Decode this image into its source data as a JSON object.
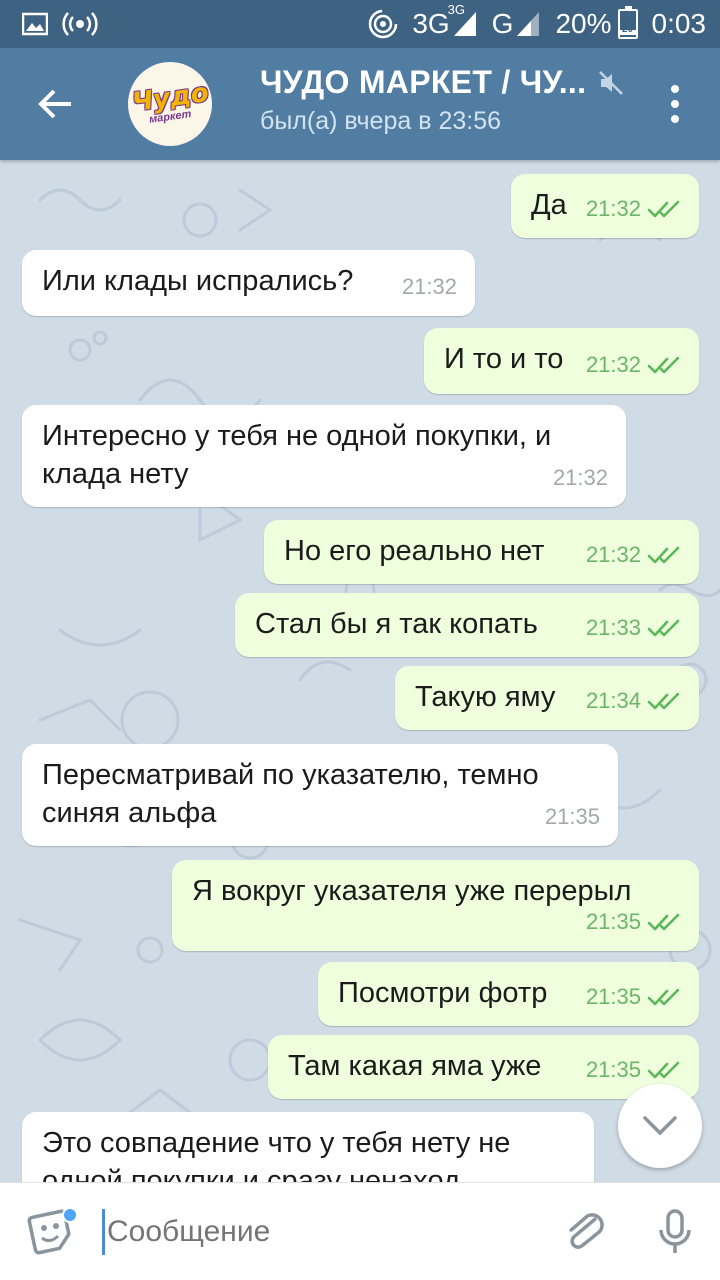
{
  "status_bar": {
    "network_3g": "3G",
    "network_3g_small": "3G",
    "network_g": "G",
    "battery_percent": "20%",
    "battery_level_text": "20",
    "battery_level": 0.2,
    "time": "0:03"
  },
  "header": {
    "title": "ЧУДО МАРКЕТ / ЧУ...",
    "subtitle": "был(а) вчера в 23:56",
    "avatar_text": "Чудо",
    "avatar_subtext": "маркет",
    "muted": true
  },
  "messages": [
    {
      "direction": "out",
      "text": "Да",
      "time": "21:32",
      "read": true
    },
    {
      "direction": "in",
      "text": "Или клады испрались?",
      "time": "21:32"
    },
    {
      "direction": "out",
      "text": "И то и то",
      "time": "21:32",
      "read": true
    },
    {
      "direction": "in",
      "lines": [
        "Интересно у тебя не одной покупки, и",
        "клада нету"
      ],
      "time": "21:32"
    },
    {
      "direction": "out",
      "text": "Но его реально нет",
      "time": "21:32",
      "read": true
    },
    {
      "direction": "out",
      "text": "Стал бы я так копать",
      "time": "21:33",
      "read": true
    },
    {
      "direction": "out",
      "text": "Такую яму",
      "time": "21:34",
      "read": true
    },
    {
      "direction": "in",
      "lines": [
        "Пересматривай по указателю, темно",
        "синяя альфа"
      ],
      "time": "21:35"
    },
    {
      "direction": "out",
      "text": "Я вокруг указателя уже перерыл",
      "time": "21:35",
      "read": true
    },
    {
      "direction": "out",
      "text": "Посмотри фотр",
      "time": "21:35",
      "read": true
    },
    {
      "direction": "out",
      "text": "Там какая яма уже",
      "time": "21:35",
      "read": true
    },
    {
      "direction": "in",
      "lines": [
        "Это совпадение что у тебя нету не",
        "одной покупки и сразу ненаход"
      ],
      "time": ""
    }
  ],
  "input": {
    "placeholder": "Сообщение"
  },
  "colors": {
    "status_bar": "#3e6282",
    "header": "#517da2",
    "chat_background": "#cfdbe5",
    "incoming_bubble": "#ffffff",
    "outgoing_bubble": "#effedd",
    "outgoing_time": "#6cb56a",
    "read_check": "#5bb75a"
  },
  "icons": {
    "status_left": [
      "image-icon",
      "broadcast-icon"
    ],
    "status_right": [
      "hotspot-icon",
      "signal-icon",
      "battery-icon"
    ],
    "header": [
      "back-arrow-icon",
      "mute-icon",
      "more-vert-icon"
    ],
    "input": [
      "sticker-icon",
      "attach-icon",
      "mic-icon"
    ],
    "chat": [
      "chevron-down-icon",
      "double-check-icon"
    ]
  }
}
